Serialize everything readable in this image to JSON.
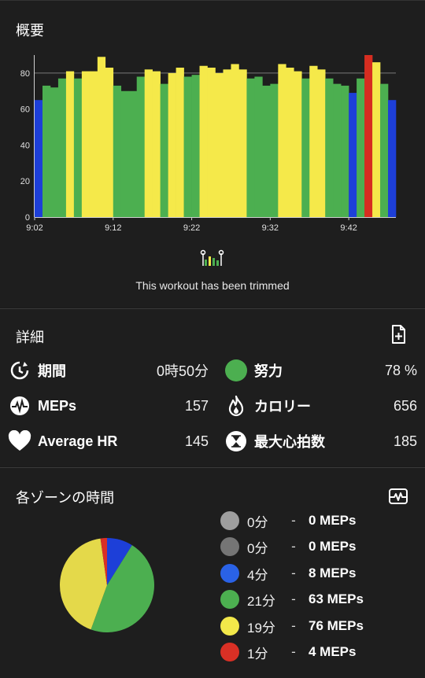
{
  "overview": {
    "title": "概要",
    "trim_text": "This workout has been trimmed"
  },
  "details": {
    "title": "詳細",
    "metrics": [
      {
        "label": "期間",
        "value": "0時50分",
        "icon": "duration-icon"
      },
      {
        "label": "努力",
        "value": "78 %",
        "icon": "effort-dot-icon"
      },
      {
        "label": "MEPs",
        "value": "157",
        "icon": "meps-icon"
      },
      {
        "label": "カロリー",
        "value": "656",
        "icon": "flame-icon"
      },
      {
        "label": "Average HR",
        "value": "145",
        "icon": "heart-icon"
      },
      {
        "label": "最大心拍数",
        "value": "185",
        "icon": "hourglass-icon"
      }
    ]
  },
  "zones": {
    "title": "各ゾーンの時間",
    "legend": [
      {
        "minutes": "0分",
        "dash": "-",
        "meps": "0 MEPs",
        "color": "#9e9e9e"
      },
      {
        "minutes": "0分",
        "dash": "-",
        "meps": "0 MEPs",
        "color": "#757575"
      },
      {
        "minutes": "4分",
        "dash": "-",
        "meps": "8 MEPs",
        "color": "#2a62e6"
      },
      {
        "minutes": "21分",
        "dash": "-",
        "meps": "63 MEPs",
        "color": "#4caf50"
      },
      {
        "minutes": "19分",
        "dash": "-",
        "meps": "76 MEPs",
        "color": "#f2e84a"
      },
      {
        "minutes": "1分",
        "dash": "-",
        "meps": "4 MEPs",
        "color": "#d93025"
      }
    ],
    "pie": [
      {
        "value": 4,
        "color": "#1d3fd8"
      },
      {
        "value": 21,
        "color": "#4caf50"
      },
      {
        "value": 19,
        "color": "#e4d94a"
      },
      {
        "value": 1,
        "color": "#d93025"
      }
    ]
  },
  "chart_data": {
    "type": "bar",
    "ylim": [
      0,
      90
    ],
    "yticks": [
      "0",
      "20",
      "40",
      "60",
      "80"
    ],
    "xticks": [
      "9:02",
      "9:12",
      "9:22",
      "9:32",
      "9:42"
    ],
    "grid": false,
    "zone_colors": {
      "blue": "#1d3fd8",
      "green": "#4caf50",
      "yellow": "#f5e94a",
      "red": "#d62d20"
    },
    "values": [
      65,
      73,
      72,
      77,
      81,
      77,
      81,
      81,
      89,
      83,
      73,
      70,
      70,
      78,
      82,
      81,
      74,
      80,
      83,
      78,
      79,
      84,
      83,
      80,
      82,
      85,
      82,
      77,
      78,
      73,
      74,
      85,
      83,
      81,
      77,
      84,
      82,
      77,
      74,
      73,
      69,
      77,
      90,
      86,
      74,
      65
    ],
    "zones": [
      "blue",
      "green",
      "green",
      "green",
      "yellow",
      "green",
      "yellow",
      "yellow",
      "yellow",
      "yellow",
      "green",
      "green",
      "green",
      "green",
      "yellow",
      "yellow",
      "green",
      "yellow",
      "yellow",
      "green",
      "green",
      "yellow",
      "yellow",
      "yellow",
      "yellow",
      "yellow",
      "yellow",
      "green",
      "green",
      "green",
      "green",
      "yellow",
      "yellow",
      "yellow",
      "green",
      "yellow",
      "yellow",
      "green",
      "green",
      "green",
      "blue",
      "green",
      "red",
      "yellow",
      "green",
      "blue"
    ]
  }
}
